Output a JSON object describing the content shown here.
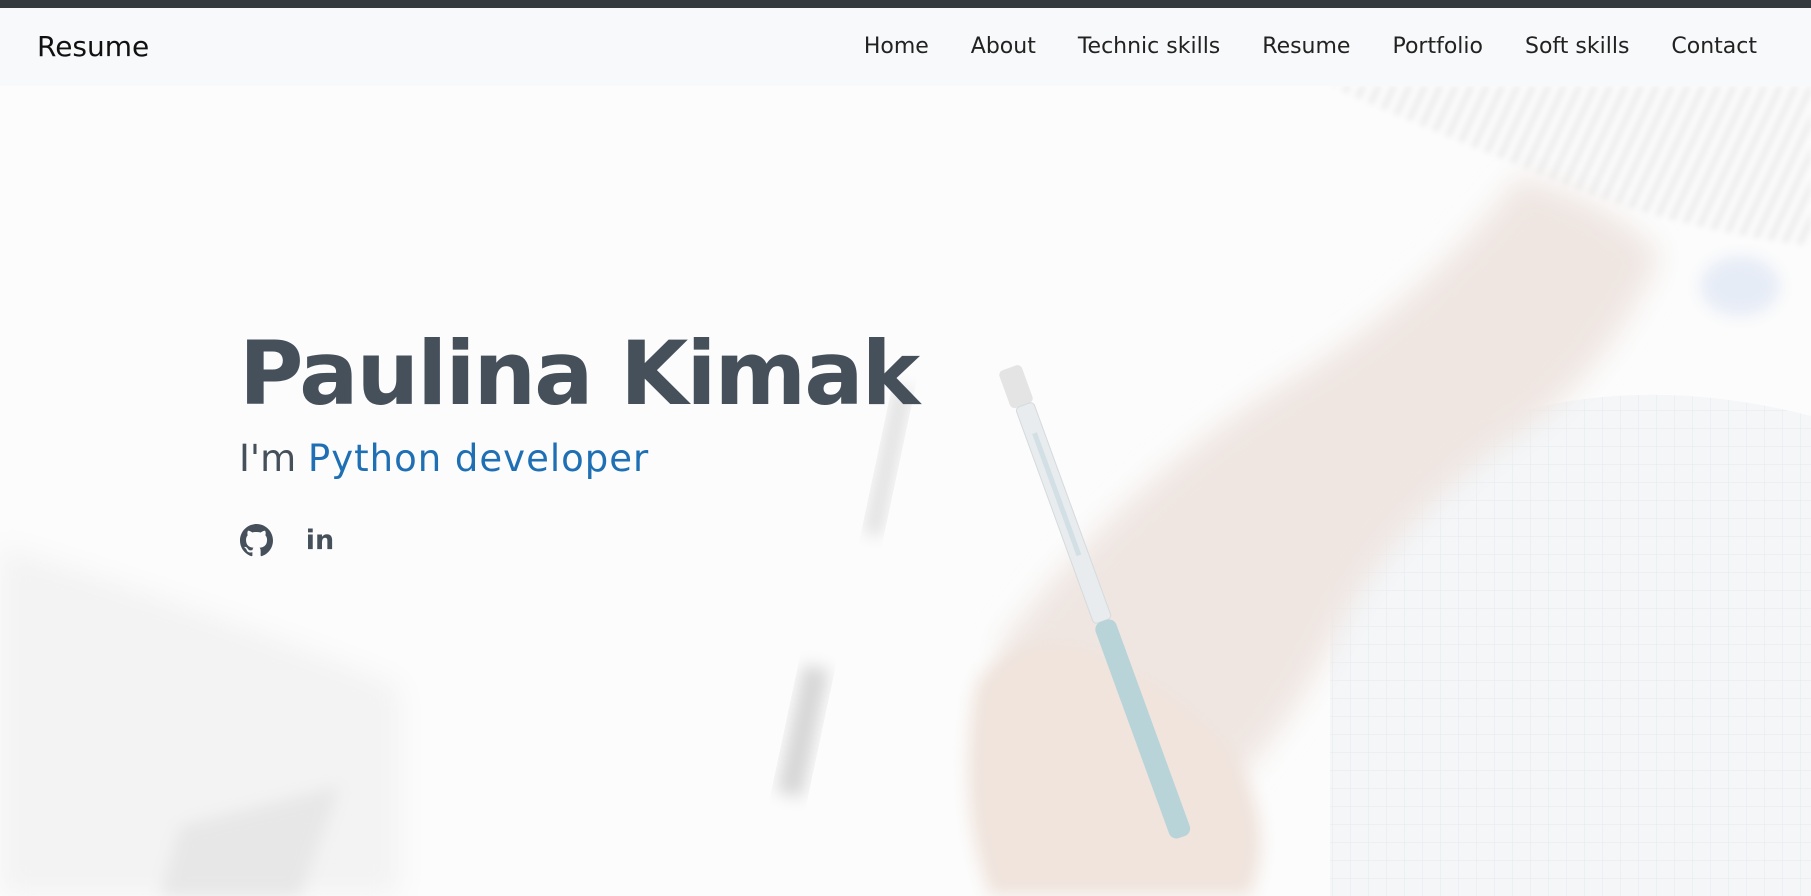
{
  "navbar": {
    "brand": "Resume",
    "items": [
      {
        "label": "Home"
      },
      {
        "label": "About"
      },
      {
        "label": "Technic skills"
      },
      {
        "label": "Resume"
      },
      {
        "label": "Portfolio"
      },
      {
        "label": "Soft skills"
      },
      {
        "label": "Contact"
      }
    ]
  },
  "hero": {
    "name": "Paulina Kimak",
    "intro": "I'm",
    "role": "Python developer",
    "social": [
      {
        "icon": "github-icon"
      },
      {
        "icon": "linkedin-icon",
        "text": "in"
      }
    ]
  },
  "colors": {
    "accent": "#1f6fb5",
    "text": "#45505b",
    "navbar_bg": "#f8f9fa",
    "top_strip": "#343a40"
  }
}
